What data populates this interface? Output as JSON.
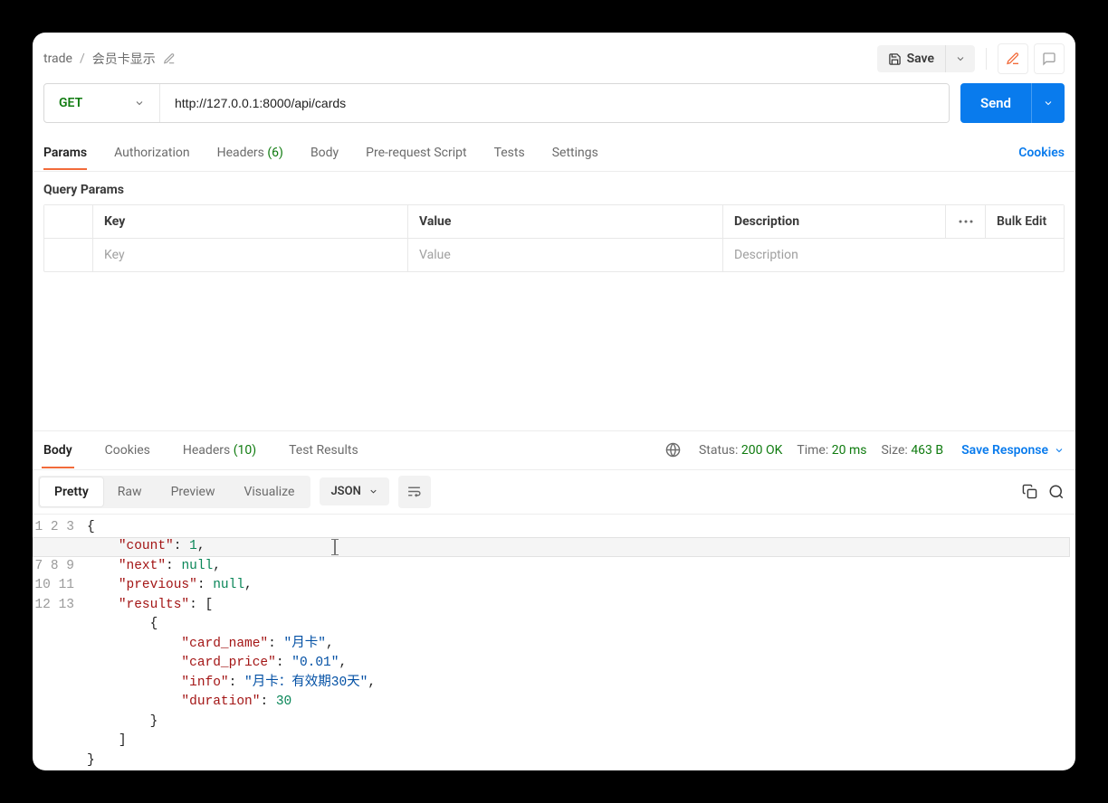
{
  "breadcrumb": {
    "root": "trade",
    "current": "会员卡显示"
  },
  "toolbar": {
    "save_label": "Save"
  },
  "request": {
    "method": "GET",
    "url": "http://127.0.0.1:8000/api/cards",
    "send_label": "Send"
  },
  "request_tabs": {
    "params": "Params",
    "authorization": "Authorization",
    "headers": "Headers",
    "headers_count": "(6)",
    "body": "Body",
    "prerequest": "Pre-request Script",
    "tests": "Tests",
    "settings": "Settings",
    "cookies": "Cookies"
  },
  "query_params": {
    "label": "Query Params",
    "header_key": "Key",
    "header_value": "Value",
    "header_desc": "Description",
    "bulk_edit": "Bulk Edit",
    "placeholder_key": "Key",
    "placeholder_value": "Value",
    "placeholder_desc": "Description"
  },
  "response_tabs": {
    "body": "Body",
    "cookies": "Cookies",
    "headers": "Headers",
    "headers_count": "(10)",
    "test_results": "Test Results"
  },
  "status": {
    "status_label": "Status:",
    "status_value": "200 OK",
    "time_label": "Time:",
    "time_value": "20 ms",
    "size_label": "Size:",
    "size_value": "463 B",
    "save_response": "Save Response"
  },
  "view": {
    "pretty": "Pretty",
    "raw": "Raw",
    "preview": "Preview",
    "visualize": "Visualize",
    "format": "JSON"
  },
  "json_body": {
    "count": 1,
    "next": null,
    "previous": null,
    "results": [
      {
        "card_name": "月卡",
        "card_price": "0.01",
        "info": "月卡：有效期30天",
        "duration": 30
      }
    ]
  }
}
